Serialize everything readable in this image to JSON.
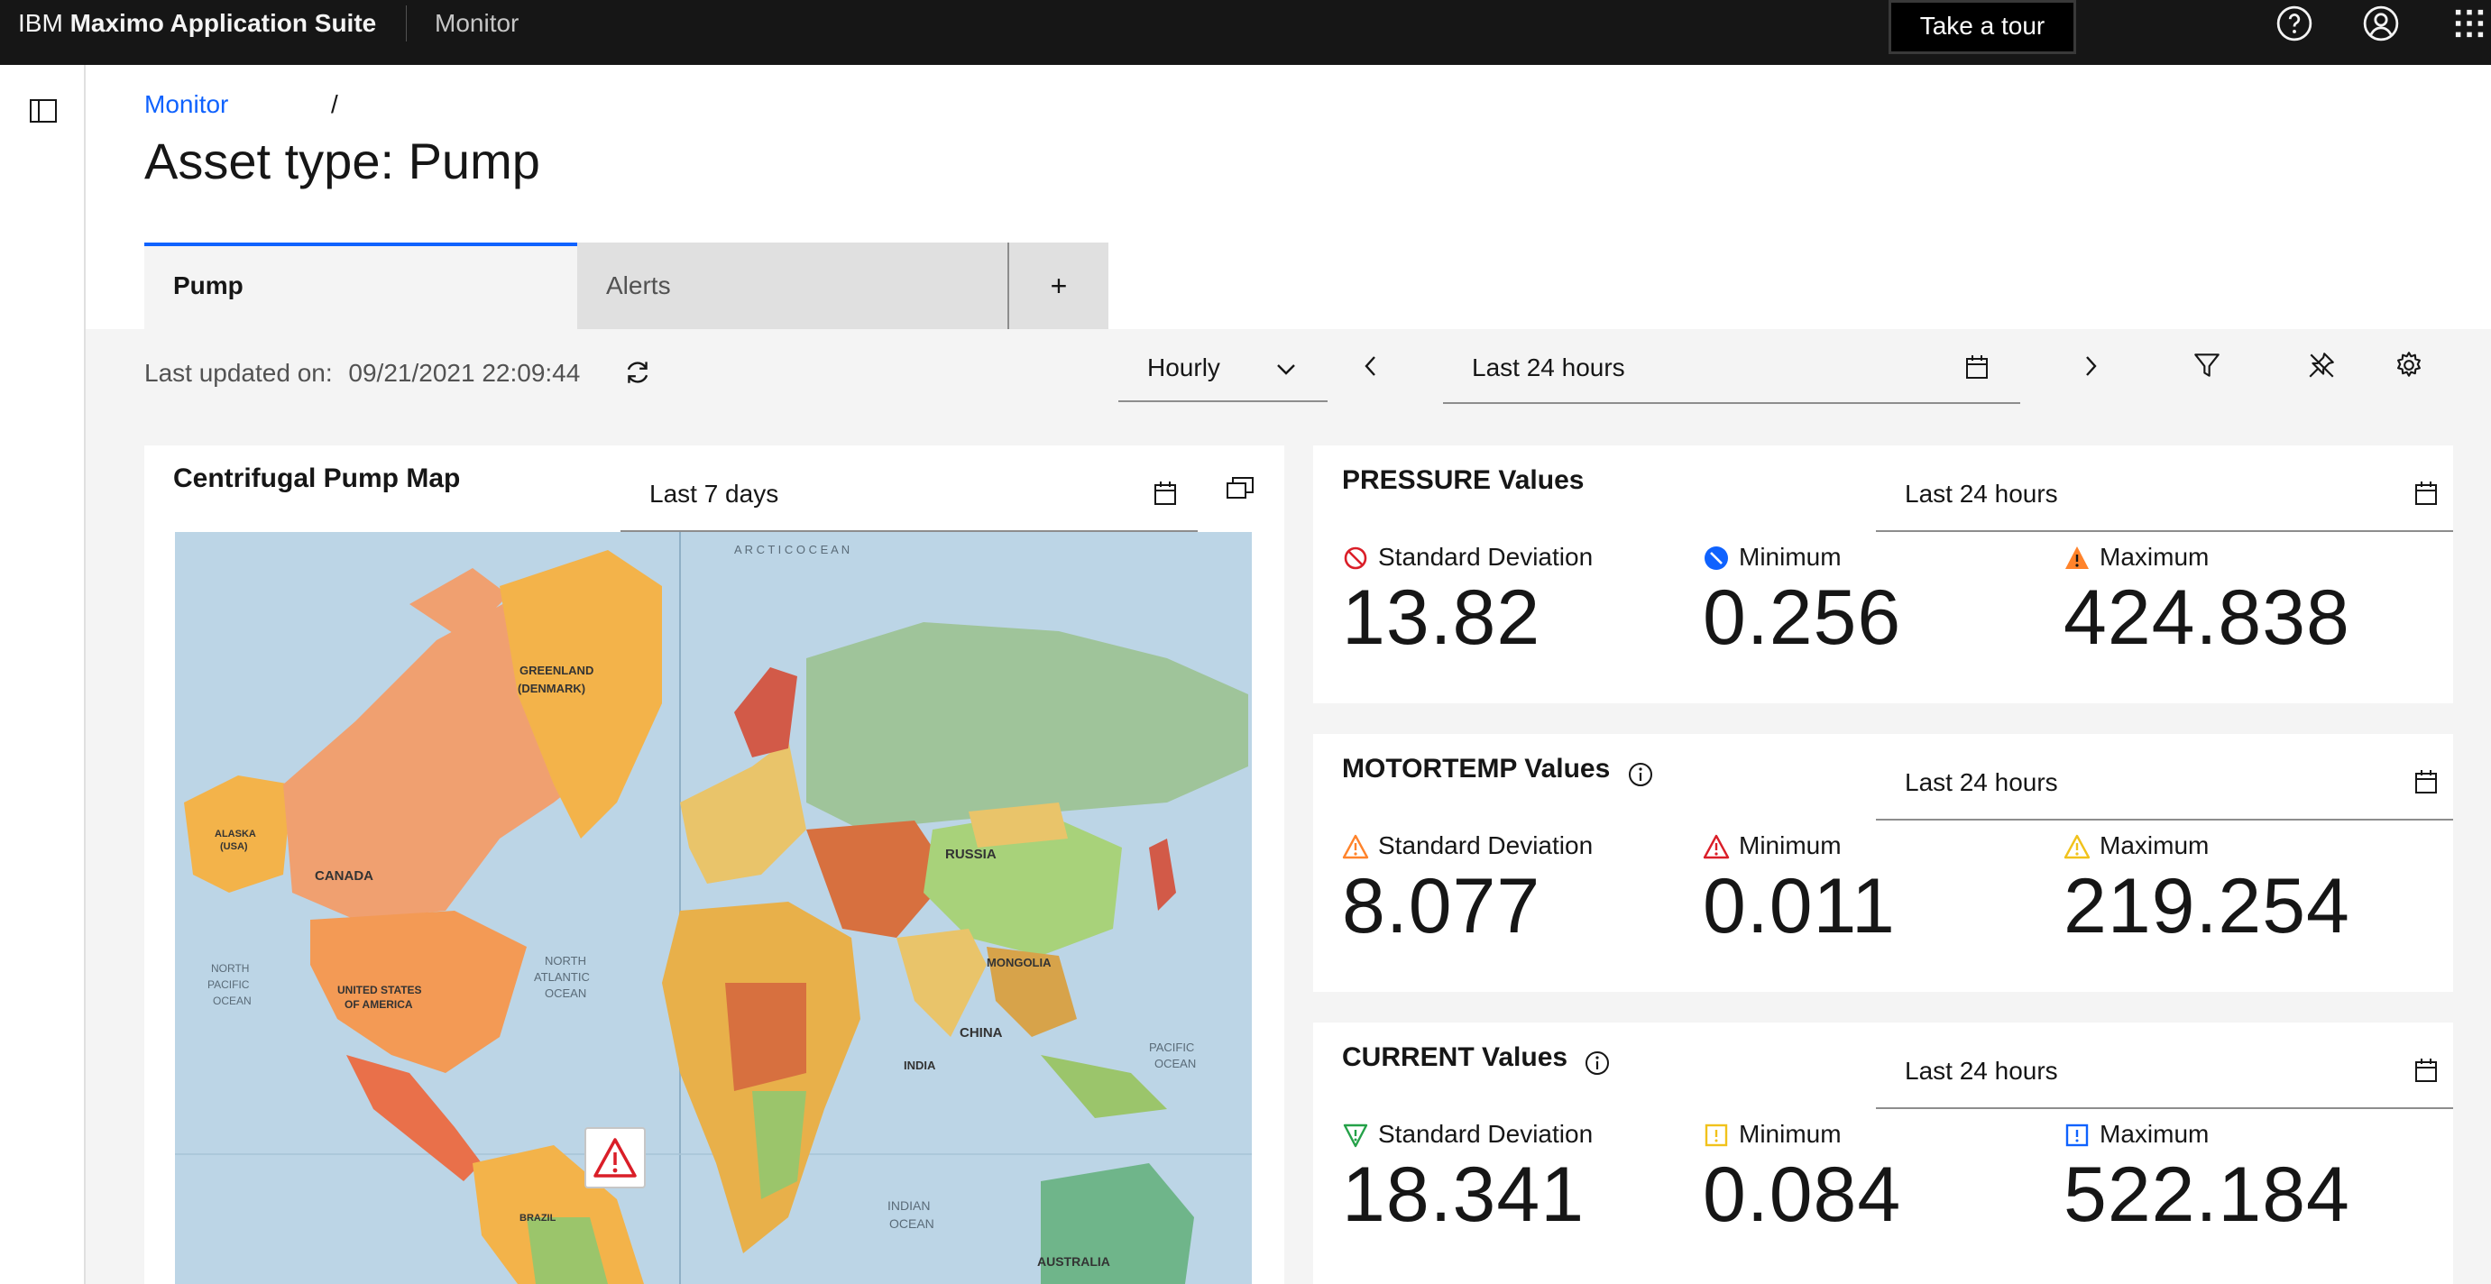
{
  "topbar": {
    "brand_prefix": "IBM",
    "brand_name": "Maximo Application Suite",
    "app_name": "Monitor",
    "tour_label": "Take a tour"
  },
  "breadcrumb": {
    "link": "Monitor",
    "separator": "/"
  },
  "page": {
    "title": "Asset type: Pump"
  },
  "tabs": [
    {
      "label": "Pump",
      "selected": true
    },
    {
      "label": "Alerts",
      "selected": false
    },
    {
      "label": "+",
      "selected": false
    }
  ],
  "toolbar": {
    "last_updated_label": "Last updated on:",
    "last_updated_value": "09/21/2021 22:09:44",
    "interval": "Hourly",
    "range": "Last 24 hours"
  },
  "map_card": {
    "title": "Centrifugal Pump Map",
    "range": "Last 7 days",
    "labels": {
      "arctic": "A R C T I C   O C E A N",
      "greenland": "GREENLAND",
      "denmark": "(DENMARK)",
      "canada": "CANADA",
      "alaska": "ALASKA",
      "usa_paren": "(USA)",
      "usa": "UNITED STATES",
      "america": "OF AMERICA",
      "north": "NORTH",
      "pacific": "PACIFIC",
      "ocean": "OCEAN",
      "atlantic": "ATLANTIC",
      "russia": "RUSSIA",
      "china": "CHINA",
      "india": "INDIA",
      "mongolia": "MONGOLIA",
      "indian": "INDIAN",
      "brazil": "BRAZIL",
      "australia": "AUSTRALIA"
    }
  },
  "cards": [
    {
      "title": "PRESSURE Values",
      "range": "Last 24 hours",
      "metrics": [
        {
          "label": "Standard Deviation",
          "value": "13.82",
          "icon": "prohibited-icon",
          "color": "#da1e28"
        },
        {
          "label": "Minimum",
          "value": "0.256",
          "icon": "minor-slash-icon",
          "color": "#0f62fe"
        },
        {
          "label": "Maximum",
          "value": "424.838",
          "icon": "warning-filled-icon",
          "color": "#ff832b"
        }
      ]
    },
    {
      "title": "MOTORTEMP Values",
      "range": "Last 24 hours",
      "metrics": [
        {
          "label": "Standard Deviation",
          "value": "8.077",
          "icon": "warning-outline-icon",
          "color": "#ff832b"
        },
        {
          "label": "Minimum",
          "value": "0.011",
          "icon": "warning-outline-icon",
          "color": "#da1e28"
        },
        {
          "label": "Maximum",
          "value": "219.254",
          "icon": "warning-outline-icon",
          "color": "#f1c21b"
        }
      ]
    },
    {
      "title": "CURRENT Values",
      "range": "Last 24 hours",
      "metrics": [
        {
          "label": "Standard Deviation",
          "value": "18.341",
          "icon": "triangle-down-icon",
          "color": "#24a148"
        },
        {
          "label": "Minimum",
          "value": "0.084",
          "icon": "warning-square-icon",
          "color": "#f1c21b"
        },
        {
          "label": "Maximum",
          "value": "522.184",
          "icon": "info-square-icon",
          "color": "#0f62fe"
        }
      ]
    }
  ]
}
